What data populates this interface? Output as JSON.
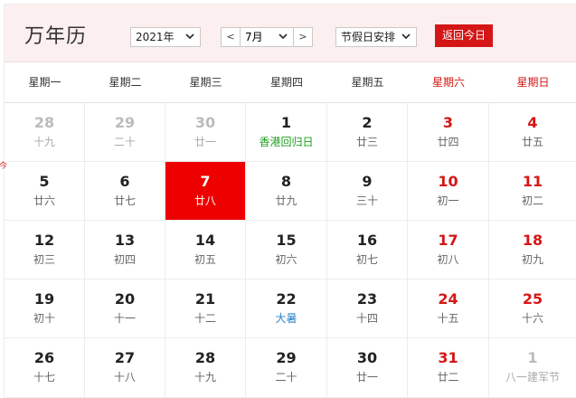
{
  "header": {
    "title": "万年历",
    "year": "2021年",
    "prev_label": "<",
    "month": "7月",
    "next_label": ">",
    "holiday_select": "节假日安排",
    "today_button": "返回今日"
  },
  "today_mark": "今",
  "weekdays": [
    "星期一",
    "星期二",
    "星期三",
    "星期四",
    "星期五",
    "星期六",
    "星期日"
  ],
  "weeks": [
    [
      {
        "d": "28",
        "l": "十九",
        "t": "other"
      },
      {
        "d": "29",
        "l": "二十",
        "t": "other"
      },
      {
        "d": "30",
        "l": "廿一",
        "t": "other"
      },
      {
        "d": "1",
        "l": "香港回归日",
        "t": "fest-green"
      },
      {
        "d": "2",
        "l": "廿三",
        "t": ""
      },
      {
        "d": "3",
        "l": "廿四",
        "t": "weekend"
      },
      {
        "d": "4",
        "l": "廿五",
        "t": "weekend"
      }
    ],
    [
      {
        "d": "5",
        "l": "廿六",
        "t": ""
      },
      {
        "d": "6",
        "l": "廿七",
        "t": ""
      },
      {
        "d": "7",
        "l": "廿八",
        "t": "today"
      },
      {
        "d": "8",
        "l": "廿九",
        "t": ""
      },
      {
        "d": "9",
        "l": "三十",
        "t": ""
      },
      {
        "d": "10",
        "l": "初一",
        "t": "weekend"
      },
      {
        "d": "11",
        "l": "初二",
        "t": "weekend"
      }
    ],
    [
      {
        "d": "12",
        "l": "初三",
        "t": ""
      },
      {
        "d": "13",
        "l": "初四",
        "t": ""
      },
      {
        "d": "14",
        "l": "初五",
        "t": ""
      },
      {
        "d": "15",
        "l": "初六",
        "t": ""
      },
      {
        "d": "16",
        "l": "初七",
        "t": ""
      },
      {
        "d": "17",
        "l": "初八",
        "t": "weekend"
      },
      {
        "d": "18",
        "l": "初九",
        "t": "weekend"
      }
    ],
    [
      {
        "d": "19",
        "l": "初十",
        "t": ""
      },
      {
        "d": "20",
        "l": "十一",
        "t": ""
      },
      {
        "d": "21",
        "l": "十二",
        "t": ""
      },
      {
        "d": "22",
        "l": "大暑",
        "t": "fest-blue"
      },
      {
        "d": "23",
        "l": "十四",
        "t": ""
      },
      {
        "d": "24",
        "l": "十五",
        "t": "weekend"
      },
      {
        "d": "25",
        "l": "十六",
        "t": "weekend"
      }
    ],
    [
      {
        "d": "26",
        "l": "十七",
        "t": ""
      },
      {
        "d": "27",
        "l": "十八",
        "t": ""
      },
      {
        "d": "28",
        "l": "十九",
        "t": ""
      },
      {
        "d": "29",
        "l": "二十",
        "t": ""
      },
      {
        "d": "30",
        "l": "廿一",
        "t": ""
      },
      {
        "d": "31",
        "l": "廿二",
        "t": "weekend"
      },
      {
        "d": "1",
        "l": "八一建军节",
        "t": "other"
      }
    ]
  ],
  "colors": {
    "accent": "#d51616",
    "header_bg": "#fbefef",
    "festival_green": "#1f9e1f",
    "solar_term_blue": "#2d86c9"
  }
}
